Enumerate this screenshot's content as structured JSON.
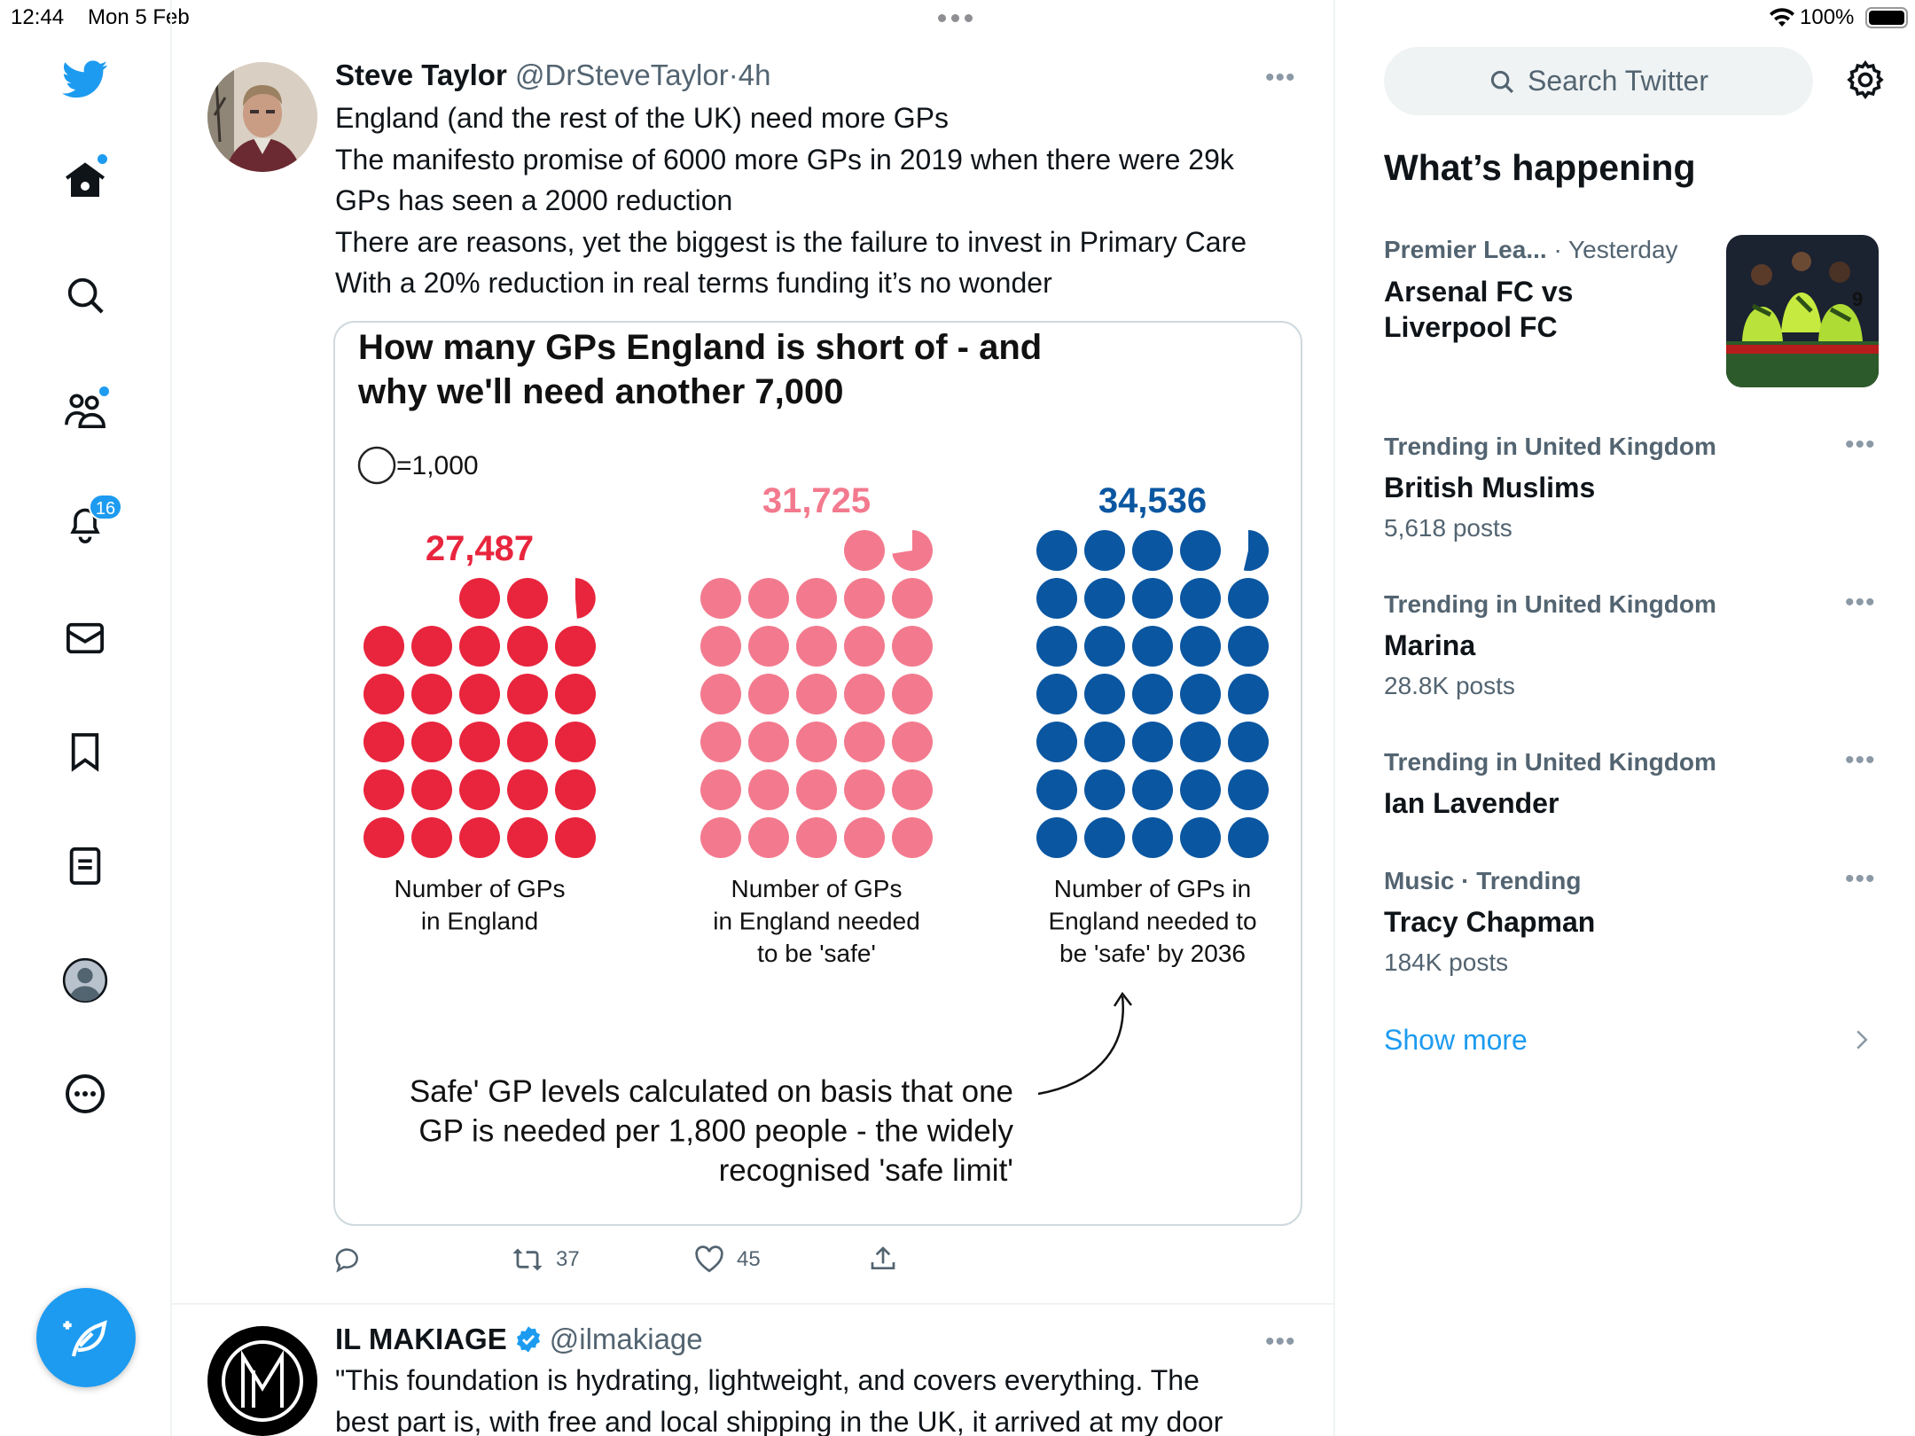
{
  "status_bar": {
    "time": "12:44",
    "date": "Mon 5 Feb",
    "battery": "100%"
  },
  "nav": {
    "notification_badge": "16"
  },
  "tweet": {
    "author_name": "Steve Taylor",
    "author_handle": "@DrSteveTaylor",
    "time_sep": "·",
    "time": "4h",
    "lines": [
      "England (and the rest of the UK) need more GPs",
      "The manifesto promise of 6000 more GPs in 2019 when there were 29k",
      "GPs has seen a 2000 reduction",
      "There are reasons, yet the biggest is the failure to invest in Primary Care",
      "With a 20% reduction in real terms funding it’s no wonder"
    ],
    "retweets": "37",
    "likes": "45"
  },
  "chart_data": {
    "type": "pictogram",
    "title_line1": "How many GPs England is short of - and",
    "title_line2": "why we'll need another 7,000",
    "legend": "=1,000",
    "unit_per_circle": 1000,
    "groups": [
      {
        "value": 27487,
        "value_label": "27,487",
        "caption": [
          "Number of GPs",
          "in England"
        ],
        "color": "#e8253d"
      },
      {
        "value": 31725,
        "value_label": "31,725",
        "caption": [
          "Number of GPs",
          "in England needed",
          "to be 'safe'"
        ],
        "color": "#f37a8e"
      },
      {
        "value": 34536,
        "value_label": "34,536",
        "caption": [
          "Number of GPs in",
          "England needed to",
          "be 'safe' by 2036"
        ],
        "color": "#0a56a1"
      }
    ],
    "annotation": [
      "Safe' GP levels calculated on basis that one",
      "GP is needed per 1,800 people - the widely",
      "recognised 'safe limit'"
    ]
  },
  "tweet2": {
    "author_name": "IL MAKIAGE",
    "author_handle": "@ilmakiage",
    "lines": [
      "\"This foundation is hydrating, lightweight, and covers everything. The",
      "best part is, with free and local shipping in the UK, it arrived at my door"
    ]
  },
  "sidebar": {
    "search_placeholder": "Search Twitter",
    "heading": "What’s happening",
    "featured": {
      "category": "Premier Lea...",
      "time": "· Yesterday",
      "title_line1": "Arsenal FC vs",
      "title_line2": "Liverpool FC"
    },
    "trends": [
      {
        "meta": "Trending in United Kingdom",
        "title": "British Muslims",
        "count": "5,618 posts"
      },
      {
        "meta": "Trending in United Kingdom",
        "title": "Marina",
        "count": "28.8K posts"
      },
      {
        "meta": "Trending in United Kingdom",
        "title": "Ian Lavender",
        "count": ""
      },
      {
        "meta": "Music · Trending",
        "title": "Tracy Chapman",
        "count": "184K posts"
      }
    ],
    "show_more": "Show more"
  },
  "colors": {
    "accent": "#1d9bf0",
    "text": "#0f1419",
    "muted": "#536471"
  }
}
